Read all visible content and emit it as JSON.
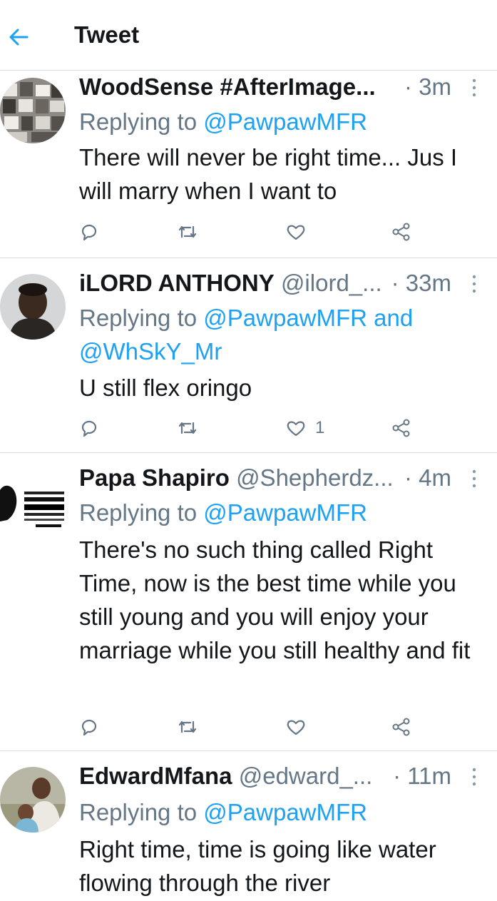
{
  "header": {
    "title": "Tweet",
    "back_icon": "arrow-left-icon"
  },
  "colors": {
    "accent": "#1da1f2",
    "muted": "#657786",
    "text": "#14171a",
    "divider": "#d6dce1"
  },
  "tweets": [
    {
      "name": "WoodSense #AfterImage...",
      "handle": "",
      "time": "· 3m",
      "replying_prefix": "Replying to ",
      "replying_to": "@PawpawMFR",
      "replying_more": "",
      "text": "There will never be right time... Jus I will marry when I want to",
      "likes": ""
    },
    {
      "name": "iLORD ANTHONY",
      "handle": "@ilord_...",
      "time": "· 33m",
      "replying_prefix": "Replying to ",
      "replying_to": "@PawpawMFR and @WhSkY_Mr",
      "replying_more": "",
      "text": "U still flex oringo",
      "likes": "1"
    },
    {
      "name": "Papa Shapiro",
      "handle": "@Shepherdz...",
      "time": "· 4m",
      "replying_prefix": "Replying to ",
      "replying_to": "@PawpawMFR",
      "replying_more": "",
      "text": "There's no such thing called Right Time, now is the best time while you still young and you will enjoy your marriage while you still healthy and fit",
      "likes": ""
    },
    {
      "name": "EdwardMfana",
      "handle": "@edward_...",
      "time": "· 11m",
      "replying_prefix": "Replying to ",
      "replying_to": "@PawpawMFR",
      "replying_more": "",
      "text": "Right time, time is going like water flowing through the river",
      "likes": ""
    }
  ],
  "icons": {
    "reply": "reply-icon",
    "retweet": "retweet-icon",
    "like": "heart-icon",
    "share": "share-icon",
    "more": "more-vertical-icon"
  },
  "avatar_image_text": "YOU'RE NOT SUPPOSED TO BE SO BLIND WITH PATRIOTISM THAT YOU CAN'T FACE REALITY WRONG IS WRONG NO MATTER WHO SAYS -MALCOLM"
}
